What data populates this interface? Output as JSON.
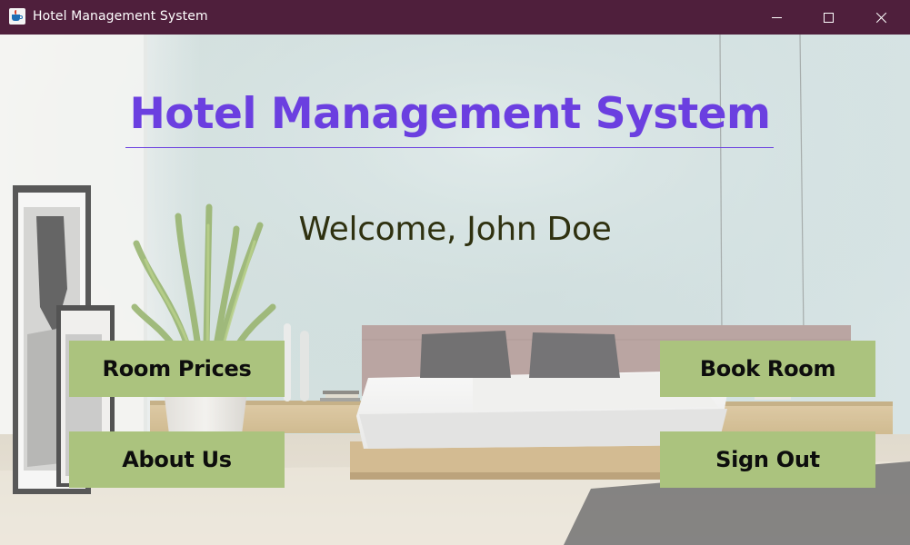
{
  "window": {
    "title": "Hotel Management System",
    "app_icon": "java-cup-icon",
    "controls": {
      "minimize_icon": "minimize-icon",
      "maximize_icon": "maximize-icon",
      "close_icon": "close-icon"
    }
  },
  "main": {
    "heading": "Hotel Management System",
    "welcome": "Welcome, John Doe",
    "buttons": {
      "room_prices": "Room Prices",
      "about_us": "About Us",
      "book_room": "Book Room",
      "sign_out": "Sign Out"
    }
  },
  "colors": {
    "titlebar": "#4f1f3c",
    "heading": "#6b3fe0",
    "welcome": "#2f3110",
    "button_bg": "#abc37e",
    "button_text": "#0d0d0d"
  }
}
